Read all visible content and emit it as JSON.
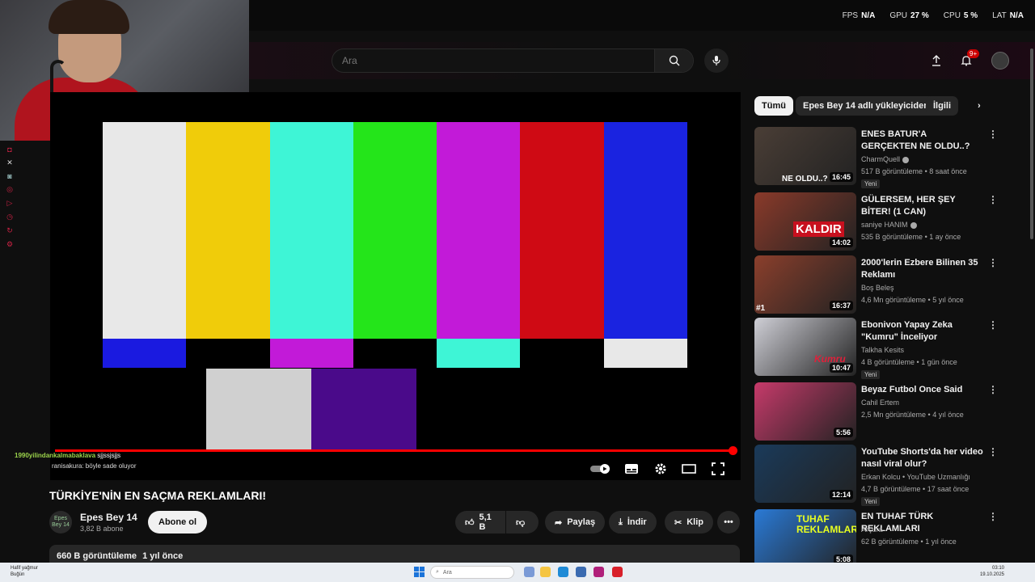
{
  "overlay": {
    "fps_label": "FPS",
    "fps_value": "N/A",
    "gpu_label": "GPU",
    "gpu_value": "27 %",
    "cpu_label": "CPU",
    "cpu_value": "5 %",
    "lat_label": "LAT",
    "lat_value": "N/A"
  },
  "header": {
    "search_placeholder": "Ara",
    "notification_count": "9+"
  },
  "chat": {
    "line1_user": "1990yilindankalmabaklava",
    "line1_msg": "sjjssjsjjs",
    "line2": "ranisakura: böyle sade oluyor"
  },
  "video": {
    "title": "TÜRKİYE'NİN EN SAÇMA REKLAMLARI!",
    "progress": 1.0,
    "colors": {
      "bars_top": [
        "#e8e8e8",
        "#f0cc0a",
        "#3ef5d6",
        "#24e51a",
        "#c21ad8",
        "#cf0a14",
        "#1a23e0"
      ],
      "bars_mid": [
        "#1a1ae0",
        "#000000",
        "#c21ad8",
        "#000000",
        "#3ef5d6",
        "#000000",
        "#e8e8e8"
      ],
      "bars_low": [
        "#d0d0d0",
        "#4a0a8a"
      ]
    }
  },
  "channel": {
    "avatar_text": "Epes Bey 14",
    "name": "Epes Bey 14",
    "subscribers": "3,82 B abone",
    "subscribe_label": "Abone ol"
  },
  "actions": {
    "likes": "5,1 B",
    "share": "Paylaş",
    "download": "İndir",
    "clip": "Klip"
  },
  "description": {
    "views": "660 B görüntüleme",
    "date": "1 yıl önce"
  },
  "chips": [
    "Tümü",
    "Epes Bey 14 adlı yükleyiciden",
    "İlgili"
  ],
  "recommendations": [
    {
      "title": "ENES BATUR'A GERÇEKTEN NE OLDU..?",
      "channel": "CharmQuell",
      "verified": true,
      "views": "517 B görüntüleme",
      "age": "8 saat önce",
      "badge": "Yeni",
      "duration": "16:45",
      "caption": "NE OLDU..?",
      "thumb": "#4a3e36"
    },
    {
      "title": "GÜLERSEM, HER ŞEY BİTER! (1 CAN)",
      "channel": "saniye HANIM",
      "verified": true,
      "views": "535 B görüntüleme",
      "age": "1 ay önce",
      "badge": "",
      "duration": "14:02",
      "caption": "KALDIR",
      "thumb": "#8a3a2a"
    },
    {
      "title": "2000'lerin Ezbere Bilinen 35 Reklamı",
      "channel": "Boş Beleş",
      "verified": false,
      "views": "4,6 Mn görüntüleme",
      "age": "5 yıl önce",
      "badge": "",
      "duration": "16:37",
      "caption": "#1",
      "thumb": "#8b3f2c"
    },
    {
      "title": "Ebonivon Yapay Zeka \"Kumru\" İnceliyor",
      "channel": "Talkha Kesits",
      "verified": false,
      "views": "4 B görüntüleme",
      "age": "1 gün önce",
      "badge": "Yeni",
      "duration": "10:47",
      "caption": "Kumru",
      "thumb": "#cfcfd6"
    },
    {
      "title": "Beyaz Futbol Once Said",
      "channel": "Cahil Ertem",
      "verified": false,
      "views": "2,5 Mn görüntüleme",
      "age": "4 yıl önce",
      "badge": "",
      "duration": "5:56",
      "caption": "",
      "thumb": "#c63a6a"
    },
    {
      "title": "YouTube Shorts'da her video nasıl viral olur?",
      "channel": "Erkan Kolcu • YouTube Uzmanlığı",
      "verified": false,
      "views": "4,7 B görüntüleme",
      "age": "17 saat önce",
      "badge": "Yeni",
      "duration": "12:14",
      "caption": "",
      "thumb": "#1a3a5a"
    },
    {
      "title": "EN TUHAF TÜRK REKLAMLARI",
      "channel": "Arçura",
      "verified": false,
      "views": "62 B görüntüleme",
      "age": "1 yıl önce",
      "badge": "",
      "duration": "5:08",
      "caption": "TUHAF REKLAMLAR",
      "thumb": "#2a7ad6"
    }
  ],
  "taskbar": {
    "weather_line1": "Hafif yağmur",
    "weather_line2": "Buğün",
    "search_placeholder": "Ara",
    "time": "03:10",
    "date": "19.10.2025"
  },
  "accent": "#ff0000"
}
